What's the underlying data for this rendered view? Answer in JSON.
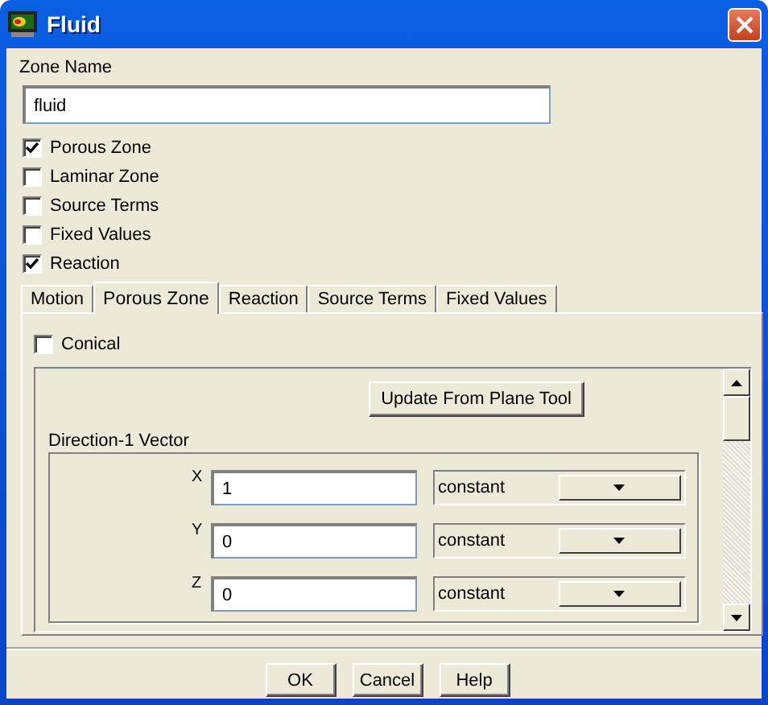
{
  "window": {
    "title": "Fluid"
  },
  "zone_name": {
    "label": "Zone Name",
    "value": "fluid"
  },
  "options": [
    {
      "label": "Porous Zone",
      "checked": true
    },
    {
      "label": "Laminar Zone",
      "checked": false
    },
    {
      "label": "Source Terms",
      "checked": false
    },
    {
      "label": "Fixed Values",
      "checked": false
    },
    {
      "label": "Reaction",
      "checked": true
    }
  ],
  "tabs": [
    {
      "label": "Motion",
      "selected": false
    },
    {
      "label": "Porous Zone",
      "selected": true
    },
    {
      "label": "Reaction",
      "selected": false
    },
    {
      "label": "Source Terms",
      "selected": false
    },
    {
      "label": "Fixed Values",
      "selected": false
    }
  ],
  "porous_zone": {
    "conical": {
      "label": "Conical",
      "checked": false
    },
    "update_button": "Update From Plane Tool",
    "direction_1": {
      "title": "Direction-1 Vector",
      "rows": [
        {
          "axis": "X",
          "value": "1",
          "method": "constant"
        },
        {
          "axis": "Y",
          "value": "0",
          "method": "constant"
        },
        {
          "axis": "Z",
          "value": "0",
          "method": "constant"
        }
      ]
    }
  },
  "buttons": [
    "OK",
    "Cancel",
    "Help"
  ]
}
